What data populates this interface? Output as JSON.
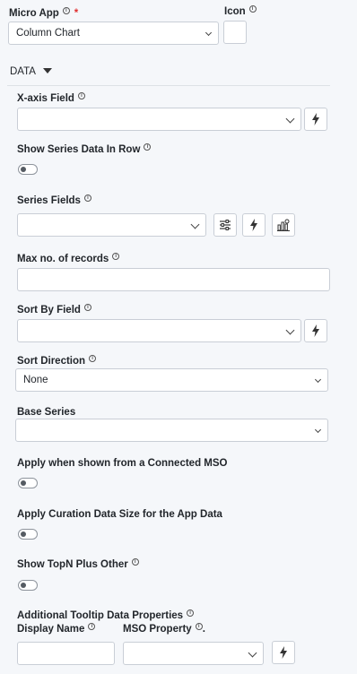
{
  "micro_app": {
    "label": "Micro App",
    "required_mark": "*",
    "value": "Column Chart"
  },
  "icon_field": {
    "label": "Icon"
  },
  "section": {
    "label": "DATA"
  },
  "x_axis": {
    "label": "X-axis Field",
    "value": ""
  },
  "show_series_in_row": {
    "label": "Show Series Data In Row",
    "enabled": false
  },
  "series_fields": {
    "label": "Series Fields",
    "value": ""
  },
  "max_records": {
    "label": "Max no. of records",
    "value": ""
  },
  "sort_by": {
    "label": "Sort By Field",
    "value": ""
  },
  "sort_direction": {
    "label": "Sort Direction",
    "value": "None"
  },
  "base_series": {
    "label": "Base Series",
    "value": ""
  },
  "apply_connected_mso": {
    "label": "Apply when shown from a Connected MSO",
    "enabled": false
  },
  "apply_curation": {
    "label": "Apply Curation Data Size for the App Data",
    "enabled": false
  },
  "show_topn": {
    "label": "Show TopN Plus Other",
    "enabled": false
  },
  "tooltip_props": {
    "label": "Additional Tooltip Data Properties",
    "display_name_label": "Display Name",
    "mso_property_label": "MSO Property",
    "mso_property_suffix": ".",
    "display_name_value": "",
    "mso_property_value": ""
  },
  "icons": {
    "info": "info-icon",
    "chevron": "chevron-down-icon",
    "caret": "caret-down-icon",
    "bolt": "lightning-bolt-icon",
    "sliders": "sliders-icon",
    "chart_settings": "chart-settings-icon"
  },
  "colors": {
    "background": "#f5f7fa",
    "border": "#c9ced6",
    "required": "#e03030"
  }
}
